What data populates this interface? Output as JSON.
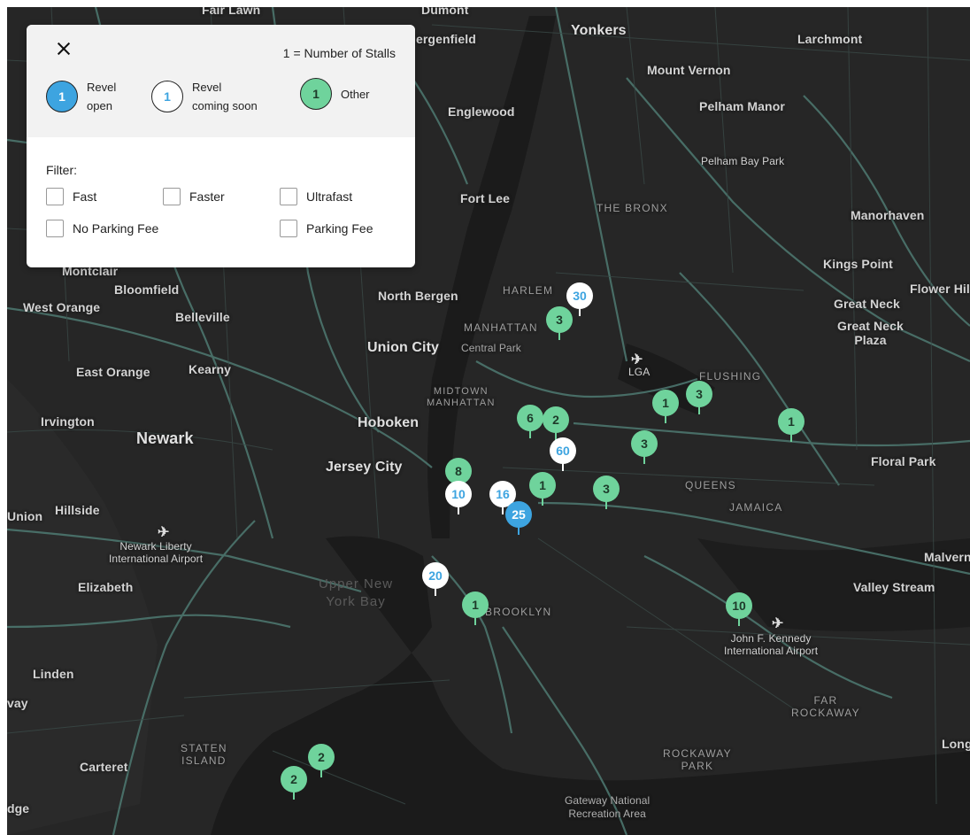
{
  "legend": {
    "close_label": "close",
    "stalls_note": "1 = Number of Stalls",
    "items": [
      {
        "count": "1",
        "line1": "Revel",
        "line2": "open"
      },
      {
        "count": "1",
        "line1": "Revel",
        "line2": "coming soon"
      },
      {
        "count": "1",
        "line1": "Other",
        "line2": ""
      }
    ],
    "filter_title": "Filter:",
    "filters": [
      "Fast",
      "Faster",
      "Ultrafast",
      "No Parking Fee",
      "Parking Fee"
    ]
  },
  "map_labels": {
    "fair_lawn": "Fair Lawn",
    "dumont": "Dumont",
    "bergenfield": "ergenfield",
    "yonkers": "Yonkers",
    "larchmont": "Larchmont",
    "mount_vernon": "Mount Vernon",
    "pelham_manor": "Pelham Manor",
    "englewood": "Englewood",
    "pelham_bay_park": "Pelham Bay Park",
    "fort_lee": "Fort Lee",
    "the_bronx": "THE BRONX",
    "manorhaven": "Manorhaven",
    "kings_point": "Kings Point",
    "flower_hill": "Flower Hil",
    "montclair": "Montclair",
    "bloomfield": "Bloomfield",
    "north_bergen": "North Bergen",
    "harlem": "HARLEM",
    "great_neck": "Great Neck",
    "great_neck_plaza_1": "Great Neck",
    "great_neck_plaza_2": "Plaza",
    "west_orange": "West Orange",
    "belleville": "Belleville",
    "manhattan": "MANHATTAN",
    "union_city": "Union City",
    "central_park": "Central Park",
    "east_orange": "East Orange",
    "kearny": "Kearny",
    "lga": "LGA",
    "flushing": "FLUSHING",
    "midtown_1": "MIDTOWN",
    "midtown_2": "MANHATTAN",
    "hoboken": "Hoboken",
    "newark": "Newark",
    "irvington": "Irvington",
    "jersey_city": "Jersey City",
    "floral_park": "Floral Park",
    "queens": "QUEENS",
    "jamaica": "JAMAICA",
    "union": "Union",
    "hillside": "Hillside",
    "newark_airport_1": "Newark Liberty",
    "newark_airport_2": "International Airport",
    "malverne": "Malvern",
    "elizabeth": "Elizabeth",
    "upper_bay_1": "Upper New",
    "upper_bay_2": "York Bay",
    "valley_stream": "Valley Stream",
    "brooklyn": "BROOKLYN",
    "jfk_1": "John F. Kennedy",
    "jfk_2": "International Airport",
    "linden": "Linden",
    "way": "vay",
    "far_rockaway_1": "FAR",
    "far_rockaway_2": "ROCKAWAY",
    "staten_island_1": "STATEN",
    "staten_island_2": "ISLAND",
    "carteret": "Carteret",
    "rockaway_park_1": "ROCKAWAY",
    "rockaway_park_2": "PARK",
    "long": "Long",
    "edge": "dge",
    "gateway_1": "Gateway National",
    "gateway_2": "Recreation Area"
  },
  "markers": [
    {
      "count": "30",
      "kind": "soon"
    },
    {
      "count": "3",
      "kind": "other"
    },
    {
      "count": "1",
      "kind": "other"
    },
    {
      "count": "3",
      "kind": "other"
    },
    {
      "count": "1",
      "kind": "other"
    },
    {
      "count": "6",
      "kind": "other"
    },
    {
      "count": "2",
      "kind": "other"
    },
    {
      "count": "60",
      "kind": "soon"
    },
    {
      "count": "3",
      "kind": "other"
    },
    {
      "count": "8",
      "kind": "other"
    },
    {
      "count": "1",
      "kind": "other"
    },
    {
      "count": "3",
      "kind": "other"
    },
    {
      "count": "10",
      "kind": "soon"
    },
    {
      "count": "16",
      "kind": "soon"
    },
    {
      "count": "25",
      "kind": "open"
    },
    {
      "count": "20",
      "kind": "soon"
    },
    {
      "count": "1",
      "kind": "other"
    },
    {
      "count": "10",
      "kind": "other"
    },
    {
      "count": "2",
      "kind": "other"
    },
    {
      "count": "2",
      "kind": "other"
    }
  ],
  "colors": {
    "map_bg": "#262626",
    "land_dark": "#1c1c1c",
    "road": "#3f5a55",
    "highway": "#4e7a72",
    "revel_open": "#3da4e0",
    "revel_soon": "#ffffff",
    "other": "#6fd39c"
  }
}
